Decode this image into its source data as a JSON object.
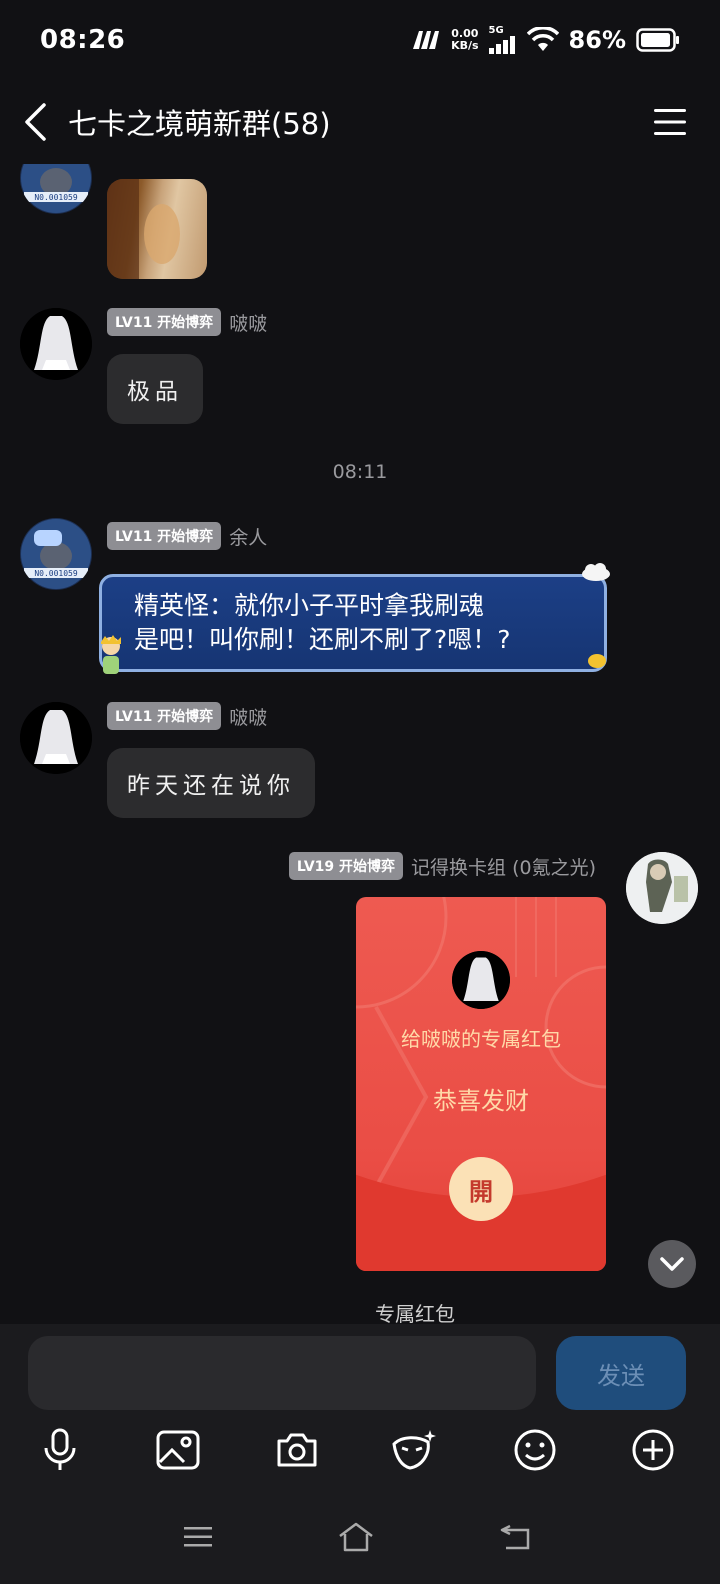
{
  "status_bar": {
    "time": "08:26",
    "net_speed_value": "0.00",
    "net_speed_unit": "KB/s",
    "network": "5G",
    "battery": "86%"
  },
  "header": {
    "title": "七卡之境萌新群(58)"
  },
  "messages": [
    {
      "type": "image",
      "sender_side": "left"
    },
    {
      "badge": "LV11 开始博弈",
      "sender": "啵啵",
      "text": "极品"
    },
    {
      "badge": "LV11 开始博弈",
      "sender": "余人",
      "text_line1": "精英怪：就你小子平时拿我刷魂",
      "text_line2": "是吧！叫你刷！还刷不刷了?嗯！?"
    },
    {
      "badge": "LV11 开始博弈",
      "sender": "啵啵",
      "text": "昨天还在说你"
    },
    {
      "badge": "LV19 开始博弈",
      "sender": "记得换卡组 (0氪之光)"
    }
  ],
  "time_divider": "08:11",
  "red_packet": {
    "to": "给啵啵的专属红包",
    "wish": "恭喜发财",
    "open_label": "開",
    "caption": "专属红包"
  },
  "input": {
    "placeholder": "",
    "send_label": "发送"
  },
  "toolbar": [
    "mic-icon",
    "image-icon",
    "camera-icon",
    "mask-icon",
    "emoji-icon",
    "plus-icon"
  ],
  "nav": [
    "menu-icon",
    "home-icon",
    "back-icon"
  ]
}
